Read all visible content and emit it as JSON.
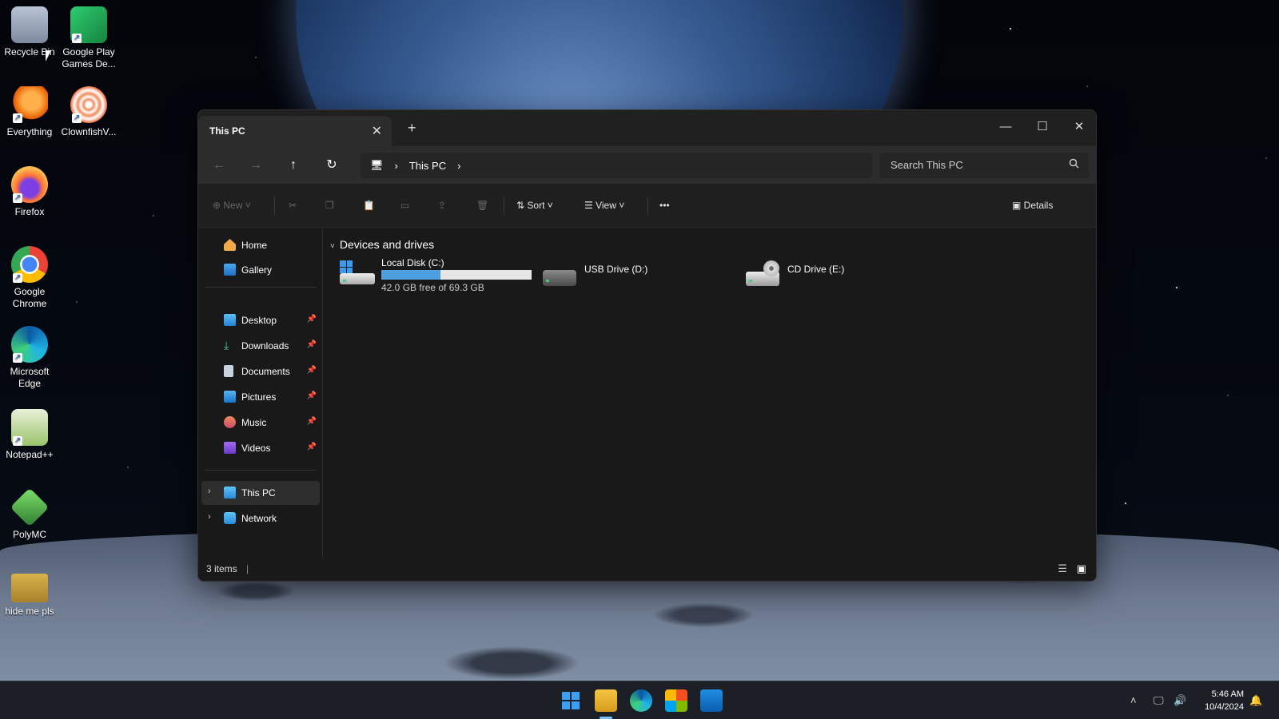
{
  "desktop": {
    "icons": [
      {
        "label": "Recycle Bin"
      },
      {
        "label": "Google Play Games De..."
      },
      {
        "label": "Everything"
      },
      {
        "label": "ClownfishV..."
      },
      {
        "label": "Firefox"
      },
      {
        "label": "Google Chrome"
      },
      {
        "label": "Microsoft Edge"
      },
      {
        "label": "Notepad++"
      },
      {
        "label": "PolyMC"
      },
      {
        "label": "hide me pls"
      }
    ]
  },
  "explorer": {
    "tab_title": "This PC",
    "tab_close": "✕",
    "tab_add": "+",
    "window_controls": {
      "minimize": "—",
      "maximize": "☐",
      "close": "✕"
    },
    "nav": {
      "back": "←",
      "forward": "→",
      "up": "↑",
      "refresh": "↻"
    },
    "breadcrumb": {
      "root_icon": "🖥",
      "sep": "›",
      "location": "This PC"
    },
    "search_placeholder": "Search This PC",
    "toolbar": {
      "new": "New",
      "sort": "Sort",
      "view": "View",
      "more": "•••",
      "details": "Details"
    },
    "sidebar": {
      "quick": [
        {
          "label": "Home"
        },
        {
          "label": "Gallery"
        }
      ],
      "pinned": [
        {
          "label": "Desktop"
        },
        {
          "label": "Downloads"
        },
        {
          "label": "Documents"
        },
        {
          "label": "Pictures"
        },
        {
          "label": "Music"
        },
        {
          "label": "Videos"
        }
      ],
      "tree": [
        {
          "label": "This PC"
        },
        {
          "label": "Network"
        }
      ]
    },
    "group_header": "Devices and drives",
    "drives": [
      {
        "name": "Local Disk (C:)",
        "free_text": "42.0 GB free of 69.3 GB",
        "used_fraction": 0.394
      },
      {
        "name": "USB Drive (D:)"
      },
      {
        "name": "CD Drive (E:)"
      }
    ],
    "status": {
      "items": "3 items"
    }
  },
  "taskbar": {
    "time": "5:46 AM",
    "date": "10/4/2024"
  },
  "colors": {
    "accent": "#4ca0e0",
    "window_bg": "#191919"
  }
}
